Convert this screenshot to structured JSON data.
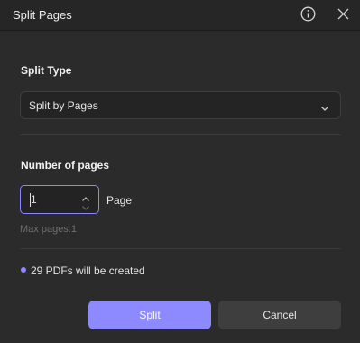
{
  "dialog": {
    "title": "Split Pages"
  },
  "split_type": {
    "label": "Split Type",
    "selected": "Split by Pages"
  },
  "pages": {
    "label": "Number of pages",
    "value": "1",
    "unit": "Page",
    "hint": "Max pages:1"
  },
  "status": {
    "text": "29 PDFs will be created",
    "dot_color": "#8d89ff"
  },
  "actions": {
    "split_label": "Split",
    "cancel_label": "Cancel",
    "accent_color": "#8d89ff"
  },
  "icons": {
    "info": "info-icon",
    "close": "close-icon",
    "chevron": "chevron-down-icon",
    "step_up": "chevron-up-icon",
    "step_down": "chevron-down-icon"
  }
}
